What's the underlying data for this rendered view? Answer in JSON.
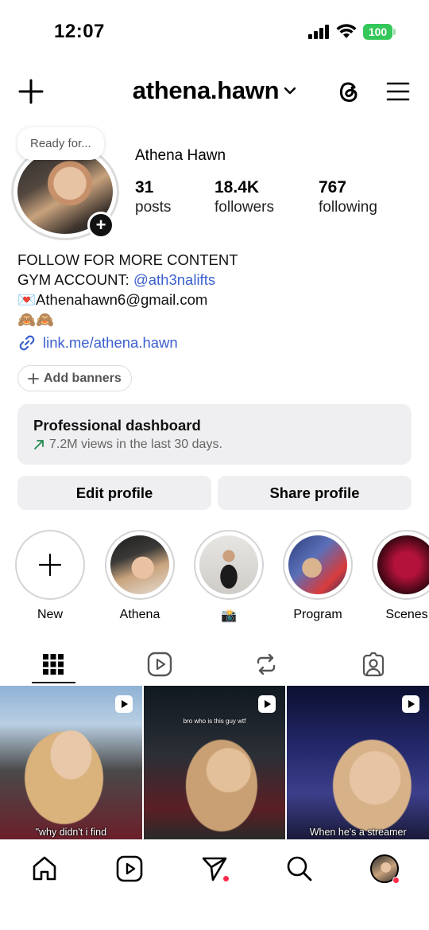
{
  "status_bar": {
    "time": "12:07",
    "battery": "100",
    "battery_color": "#34c759"
  },
  "header": {
    "username": "athena.hawn"
  },
  "note": {
    "text": "Ready for..."
  },
  "profile": {
    "full_name": "Athena Hawn",
    "stats": [
      {
        "value": "31",
        "label": "posts"
      },
      {
        "value": "18.4K",
        "label": "followers"
      },
      {
        "value": "767",
        "label": "following"
      }
    ]
  },
  "bio": {
    "line1": "FOLLOW FOR MORE CONTENT",
    "line2_prefix": "GYM ACCOUNT: ",
    "line2_mention": "@ath3nalifts",
    "line3_emoji": "💌",
    "line3_text": "Athenahawn6@gmail.com",
    "line4": "🙈🙈",
    "link": "link.me/athena.hawn"
  },
  "add_banners": {
    "label": "Add banners"
  },
  "dashboard": {
    "title": "Professional dashboard",
    "subtitle": "7.2M views in the last 30 days."
  },
  "buttons": {
    "edit": "Edit profile",
    "share": "Share profile"
  },
  "highlights": [
    {
      "label": "New"
    },
    {
      "label": "Athena"
    },
    {
      "label": "📸"
    },
    {
      "label": "Program"
    },
    {
      "label": "Scenes"
    }
  ],
  "grid": {
    "posts": [
      {
        "caption": "\"why didn't i find"
      },
      {
        "caption_top": "bro who is this guy wtf"
      },
      {
        "caption": "When he's a streamer"
      }
    ]
  },
  "colors": {
    "link": "#3a5fcf",
    "notification_dot": "#ff2a4a",
    "button_bg": "#efeff1"
  }
}
